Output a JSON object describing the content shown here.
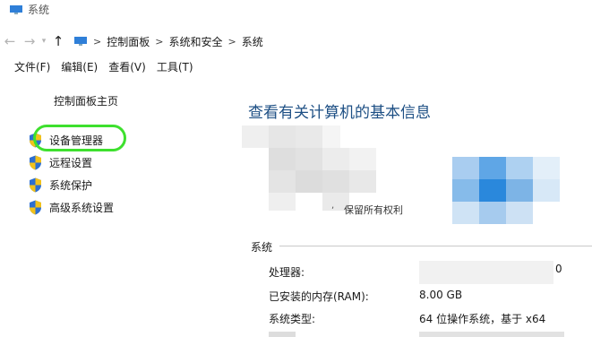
{
  "window": {
    "title": "系统"
  },
  "nav": {
    "back_icon": "left-arrow-icon",
    "forward_icon": "right-arrow-icon",
    "up_icon": "up-arrow-icon",
    "crumbs": [
      "控制面板",
      "系统和安全",
      "系统"
    ],
    "sep": ">"
  },
  "menubar": [
    "文件(F)",
    "编辑(E)",
    "查看(V)",
    "工具(T)"
  ],
  "sidebar": {
    "home": "控制面板主页",
    "items": [
      {
        "label": "设备管理器",
        "icon": "shield-icon",
        "highlighted": true
      },
      {
        "label": "远程设置",
        "icon": "shield-icon"
      },
      {
        "label": "系统保护",
        "icon": "shield-icon"
      },
      {
        "label": "高级系统设置",
        "icon": "shield-icon"
      }
    ]
  },
  "main": {
    "heading": "查看有关计算机的基本信息",
    "rights_text": "保留所有权利",
    "system_section": {
      "label": "系统",
      "rows": [
        {
          "label": "处理器:",
          "value": "",
          "edge": "0"
        },
        {
          "label": "已安装的内存(RAM):",
          "value": "8.00 GB"
        },
        {
          "label": "系统类型:",
          "value": "64 位操作系统，基于 x64"
        }
      ]
    }
  },
  "colors": {
    "heading": "#1d4f84",
    "highlight_ring": "#3ee02e",
    "shield_blue": "#2d6fd1",
    "shield_yellow": "#f2c21b"
  }
}
